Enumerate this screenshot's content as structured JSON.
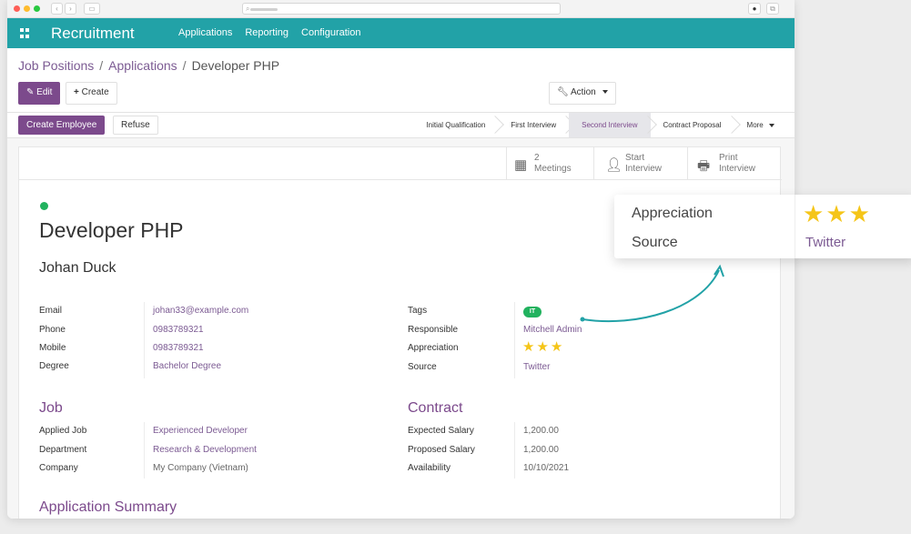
{
  "topnav": {
    "brand": "Recruitment",
    "menu": [
      "Applications",
      "Reporting",
      "Configuration"
    ]
  },
  "breadcrumb": {
    "items": [
      "Job Positions",
      "Applications",
      "Developer PHP"
    ],
    "separator": "/"
  },
  "toolbar": {
    "edit": "Edit",
    "create": "Create",
    "action": "Action"
  },
  "statusbar": {
    "create_employee": "Create Employee",
    "refuse": "Refuse",
    "stages": [
      "Initial Qualification",
      "First Interview",
      "Second Interview",
      "Contract Proposal",
      "More"
    ],
    "active_stage": "Second Interview"
  },
  "smart_buttons": [
    {
      "icon": "calendar-icon",
      "line1": "2",
      "line2": "Meetings"
    },
    {
      "icon": "user-icon",
      "line1": "Start",
      "line2": "Interview"
    },
    {
      "icon": "print-icon",
      "line1": "Print",
      "line2": "Interview"
    }
  ],
  "record": {
    "title": "Developer PHP",
    "candidate": "Johan Duck",
    "left_fields": [
      {
        "label": "Email",
        "value": "johan33@example.com"
      },
      {
        "label": "Phone",
        "value": "0983789321"
      },
      {
        "label": "Mobile",
        "value": "0983789321"
      },
      {
        "label": "Degree",
        "value": "Bachelor Degree"
      }
    ],
    "right_fields": {
      "tags_label": "Tags",
      "tag": "IT",
      "responsible_label": "Responsible",
      "responsible": "Mitchell Admin",
      "appreciation_label": "Appreciation",
      "appreciation_stars": 3,
      "source_label": "Source",
      "source": "Twitter"
    },
    "job_section": "Job",
    "job_fields": [
      {
        "label": "Applied Job",
        "value": "Experienced Developer"
      },
      {
        "label": "Department",
        "value": "Research & Development"
      },
      {
        "label": "Company",
        "value": "My Company (Vietnam)"
      }
    ],
    "contract_section": "Contract",
    "contract_fields": [
      {
        "label": "Expected Salary",
        "value": "1,200.00"
      },
      {
        "label": "Proposed Salary",
        "value": "1,200.00"
      },
      {
        "label": "Availability",
        "value": "10/10/2021"
      }
    ],
    "summary_section": "Application Summary"
  },
  "callout": {
    "appreciation_label": "Appreciation",
    "source_label": "Source",
    "source": "Twitter",
    "stars": 3
  },
  "colors": {
    "nav": "#22a2a7",
    "brand_purple": "#7c4a8c",
    "link": "#7c5b93",
    "star": "#f5c518",
    "status_green": "#21b25e"
  }
}
